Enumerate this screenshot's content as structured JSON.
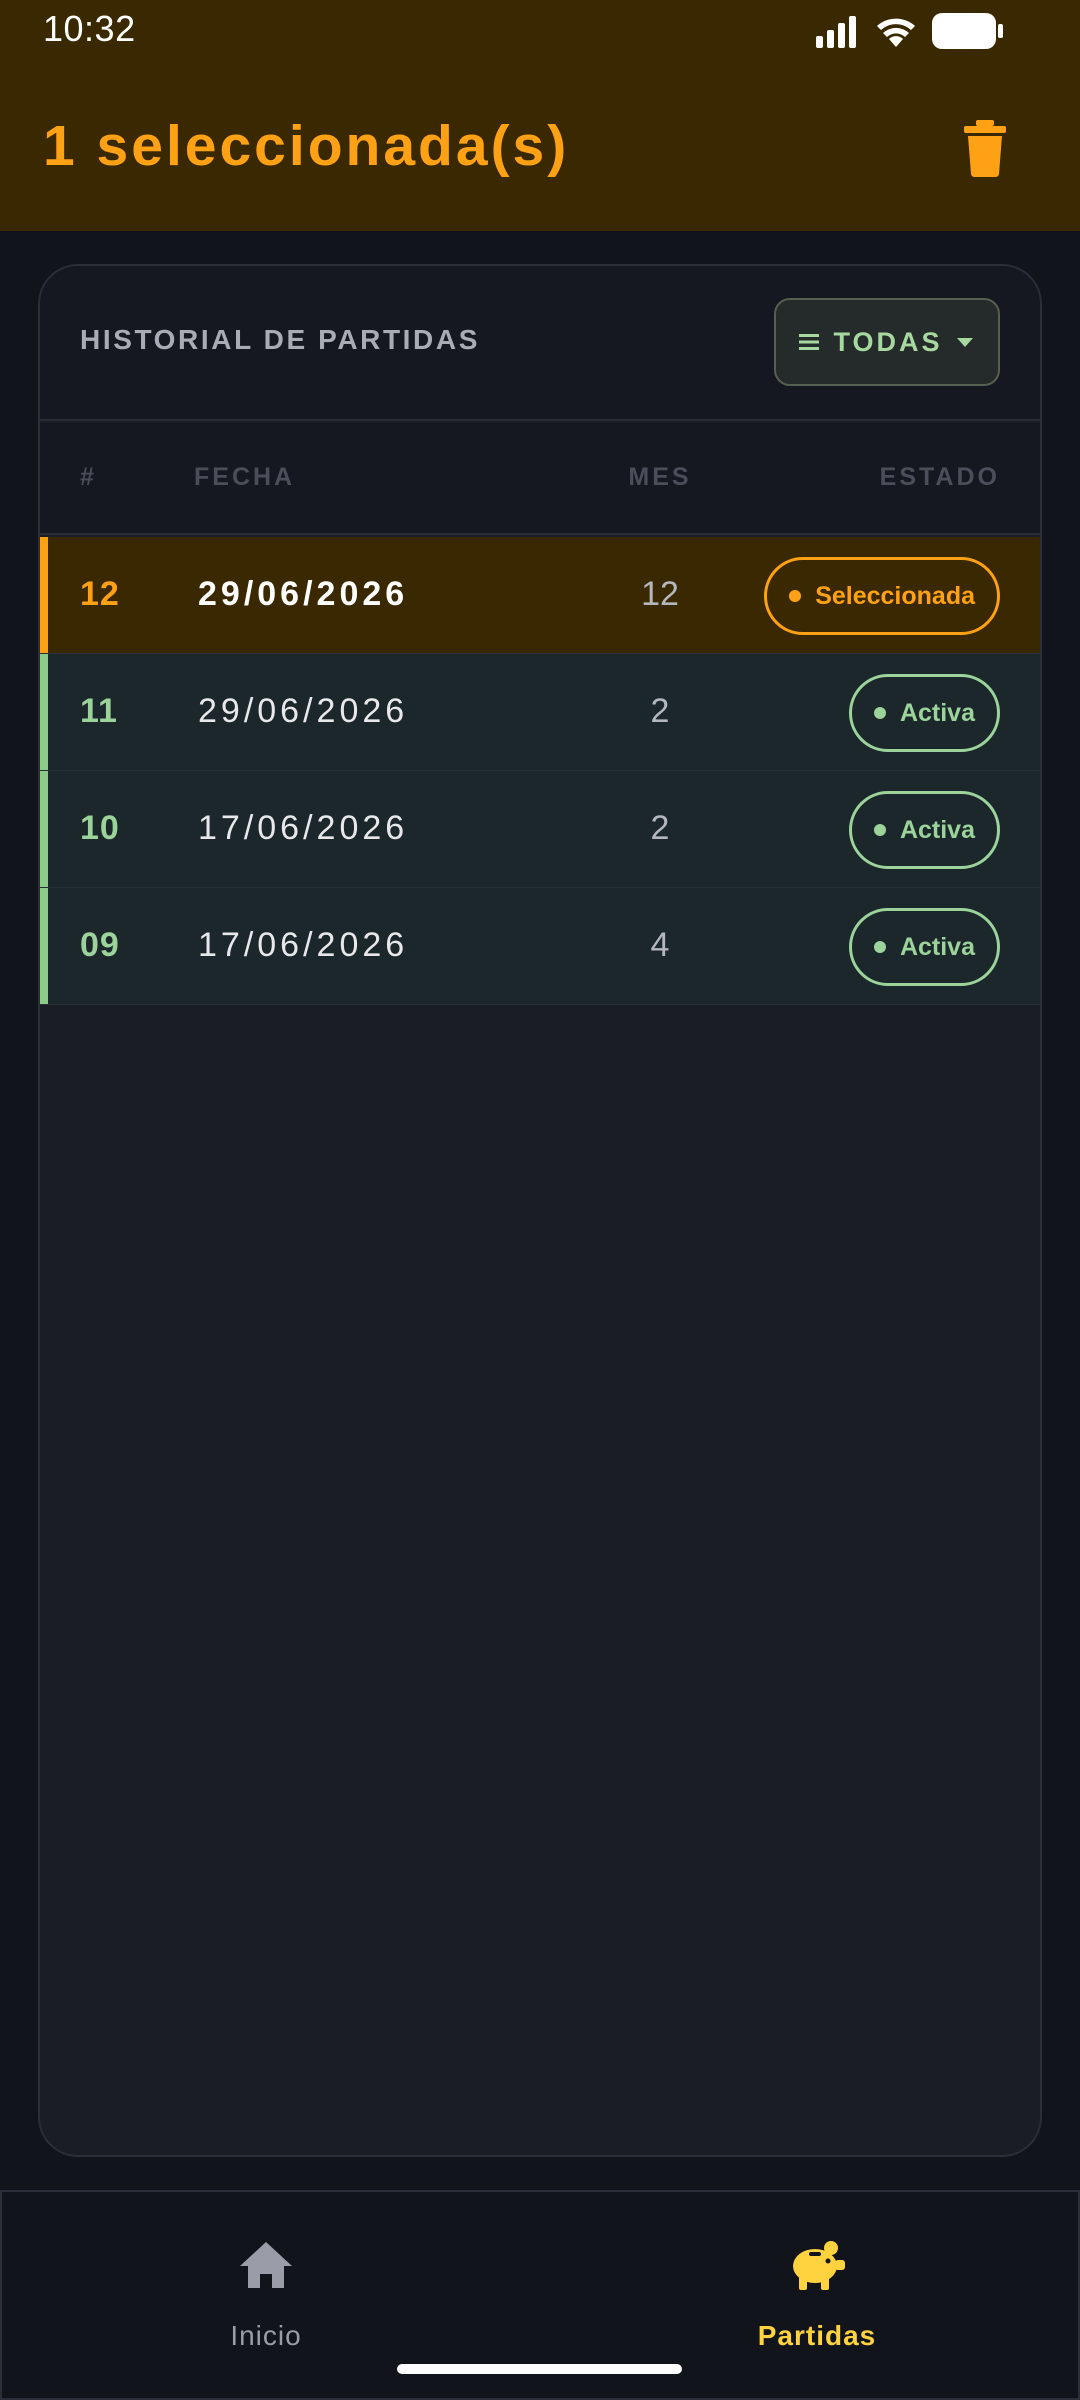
{
  "status_bar": {
    "time": "10:32"
  },
  "header": {
    "title": "1 seleccionada(s)",
    "delete_icon": "trash-icon"
  },
  "card": {
    "title": "HISTORIAL DE PARTIDAS",
    "filter": {
      "label": "TODAS",
      "icon": "list-icon",
      "chevron": "chevron-down-icon"
    },
    "columns": {
      "num": "#",
      "date": "FECHA",
      "month": "MES",
      "status": "ESTADO"
    },
    "rows": [
      {
        "num": "12",
        "date": "29/06/2026",
        "month": "12",
        "status": "Seleccionada",
        "selected": true
      },
      {
        "num": "11",
        "date": "29/06/2026",
        "month": "2",
        "status": "Activa",
        "selected": false
      },
      {
        "num": "10",
        "date": "17/06/2026",
        "month": "2",
        "status": "Activa",
        "selected": false
      },
      {
        "num": "09",
        "date": "17/06/2026",
        "month": "4",
        "status": "Activa",
        "selected": false
      }
    ]
  },
  "bottom_nav": {
    "items": [
      {
        "label": "Inicio",
        "icon": "home-icon",
        "active": false
      },
      {
        "label": "Partidas",
        "icon": "piggy-bank-icon",
        "active": true
      }
    ]
  },
  "colors": {
    "accent_orange": "#ffa114",
    "active_green": "#9bd39a",
    "nav_active_yellow": "#ffd23f",
    "header_bg": "#3a2900",
    "page_bg": "#12141b"
  }
}
